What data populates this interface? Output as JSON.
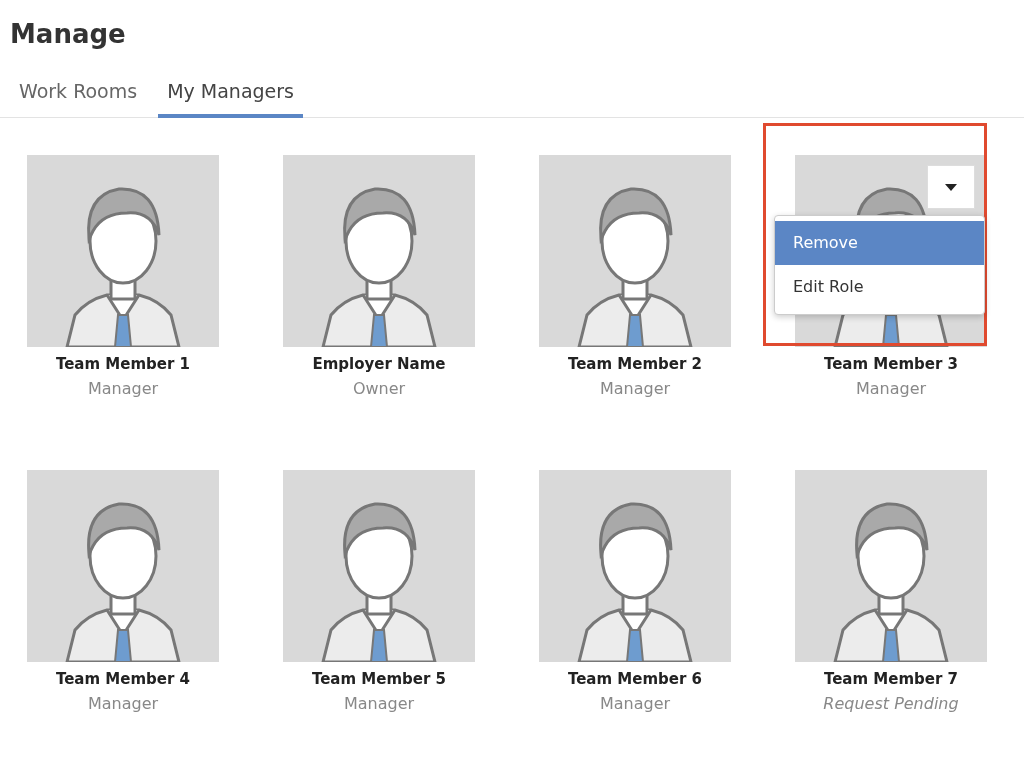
{
  "page": {
    "title": "Manage"
  },
  "tabs": [
    {
      "label": "Work Rooms",
      "selected": false
    },
    {
      "label": "My Managers",
      "selected": true
    }
  ],
  "members": [
    {
      "name": "Team Member 1",
      "role": "Manager",
      "pending": false,
      "highlighted": false
    },
    {
      "name": "Employer Name",
      "role": "Owner",
      "pending": false,
      "highlighted": false
    },
    {
      "name": "Team Member 2",
      "role": "Manager",
      "pending": false,
      "highlighted": false
    },
    {
      "name": "Team Member 3",
      "role": "Manager",
      "pending": false,
      "highlighted": true,
      "menu": [
        {
          "label": "Remove",
          "selected": true
        },
        {
          "label": "Edit Role",
          "selected": false
        }
      ]
    },
    {
      "name": "Team Member 4",
      "role": "Manager",
      "pending": false,
      "highlighted": false
    },
    {
      "name": "Team Member 5",
      "role": "Manager",
      "pending": false,
      "highlighted": false
    },
    {
      "name": "Team Member 6",
      "role": "Manager",
      "pending": false,
      "highlighted": false
    },
    {
      "name": "Team Member 7",
      "role": "Request Pending",
      "pending": true,
      "highlighted": false
    }
  ]
}
